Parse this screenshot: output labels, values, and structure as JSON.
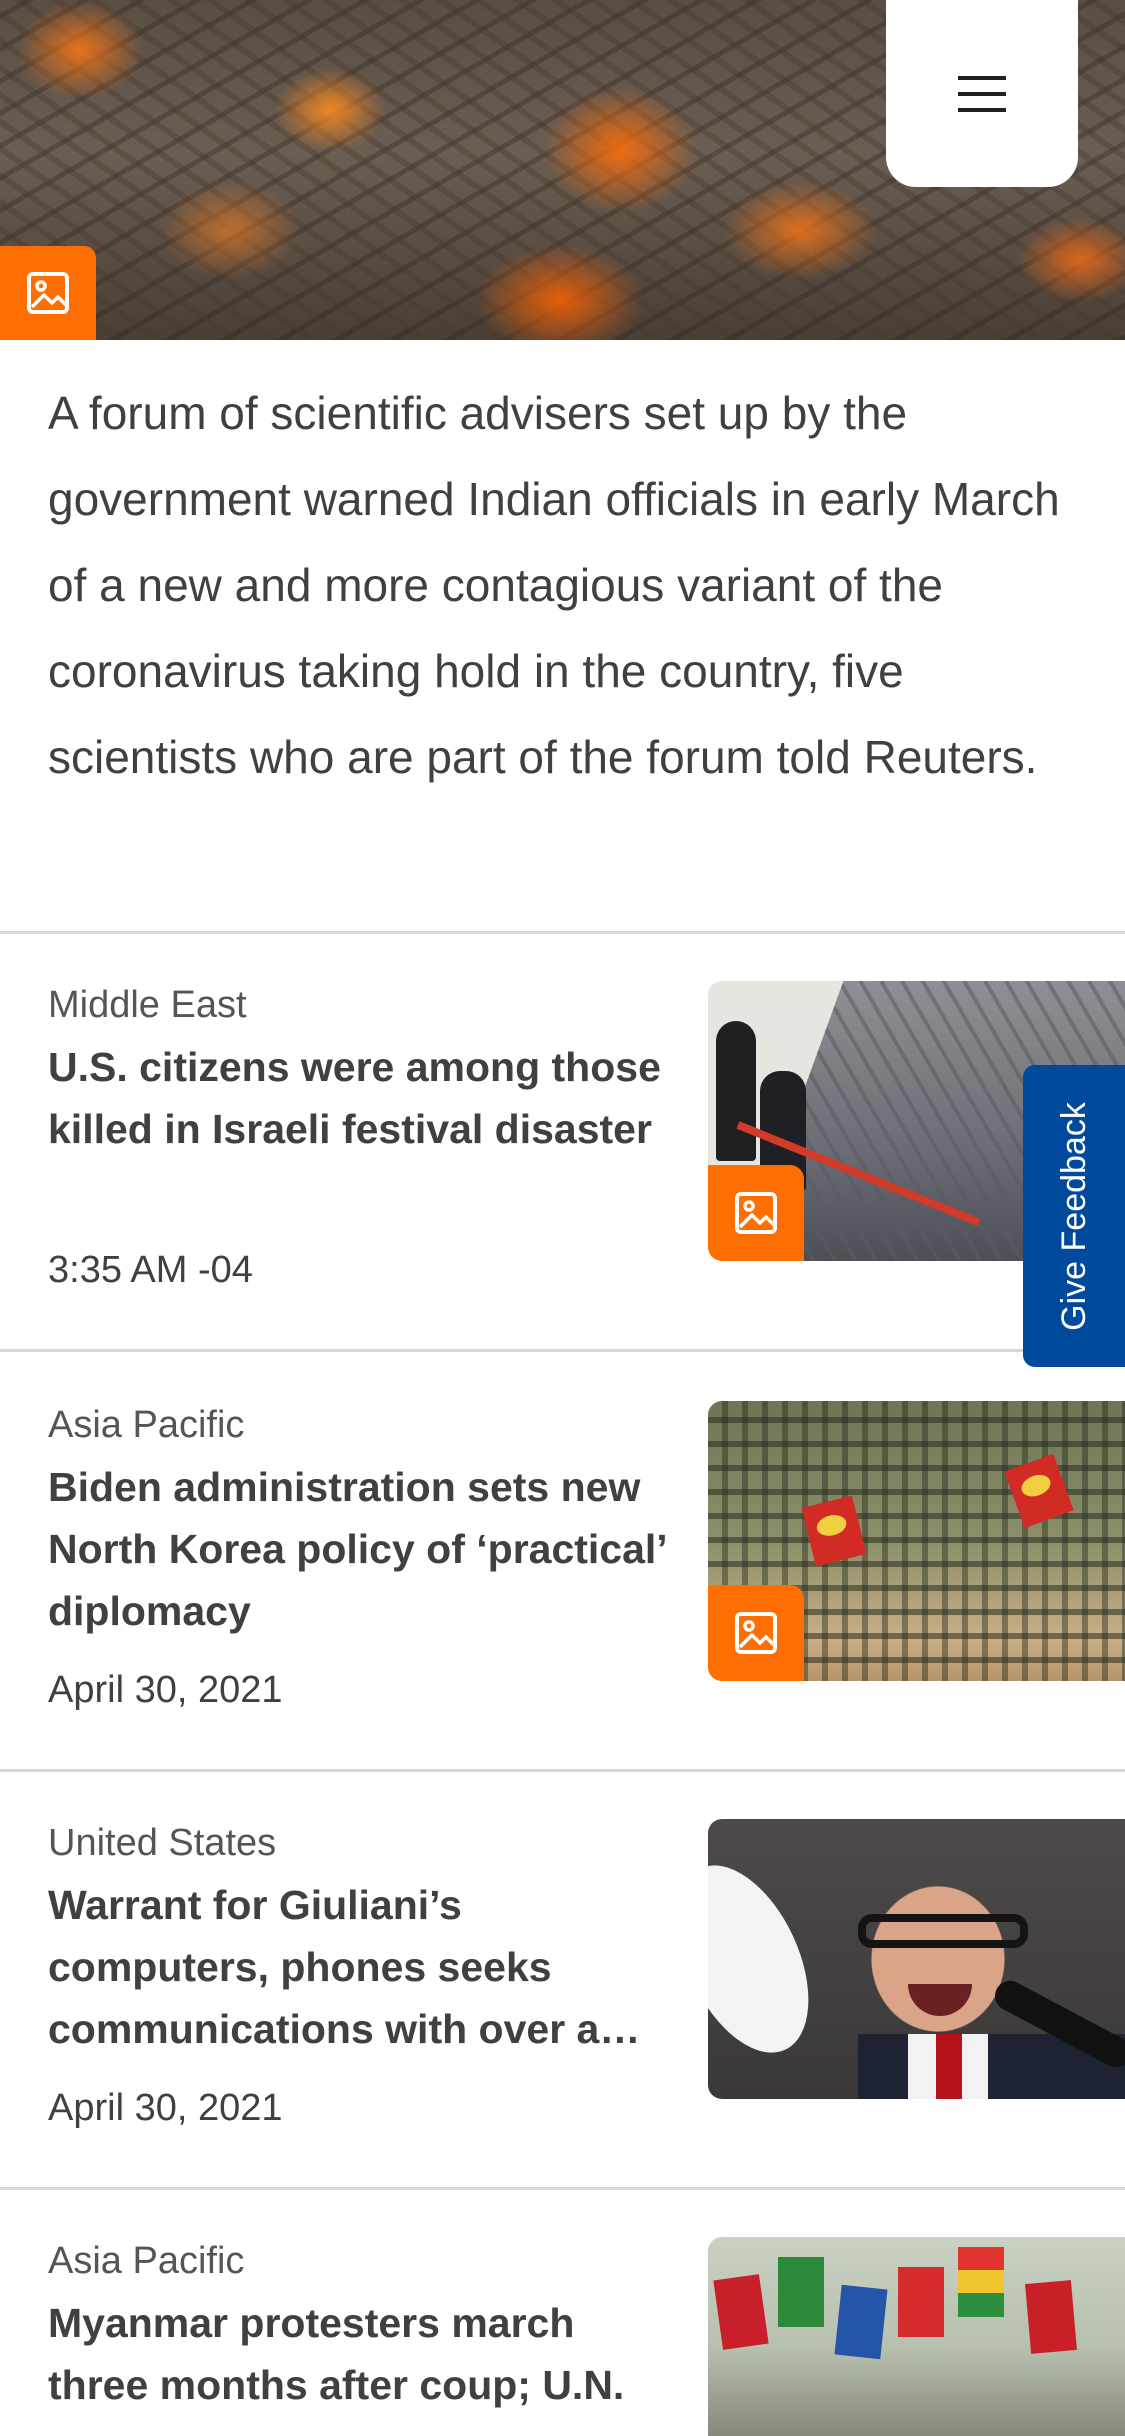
{
  "hero": {
    "menu_icon": "hamburger-menu-icon",
    "badge_icon": "image-icon"
  },
  "lede": {
    "text": "A forum of scientific advisers set up by the government warned Indian officials in early March of a new and more contagious variant of the coronavirus taking hold in the country, five scientists who are part of the forum told Reuters."
  },
  "stories": [
    {
      "section": "Middle East",
      "headline": "U.S. citizens were among those killed in Israeli festival disaster",
      "time": "3:35 AM -04",
      "has_gallery_badge": true
    },
    {
      "section": "Asia Pacific",
      "headline": "Biden administration sets new North Korea policy of ‘practical’ diplomacy",
      "time": "April 30, 2021",
      "has_gallery_badge": true
    },
    {
      "section": "United States",
      "headline": "Warrant for Giuliani’s computers, phones seeks communications with over a dozen people",
      "time": "April 30, 2021",
      "has_gallery_badge": false
    },
    {
      "section": "Asia Pacific",
      "headline": "Myanmar protesters march three months after coup; U.N.",
      "has_gallery_badge": false
    }
  ],
  "feedback": {
    "label": "Give Feedback"
  },
  "colors": {
    "accent_orange": "#ff6e00",
    "feedback_blue": "#004a9e",
    "text": "#404040",
    "divider": "#d9d9d9"
  }
}
